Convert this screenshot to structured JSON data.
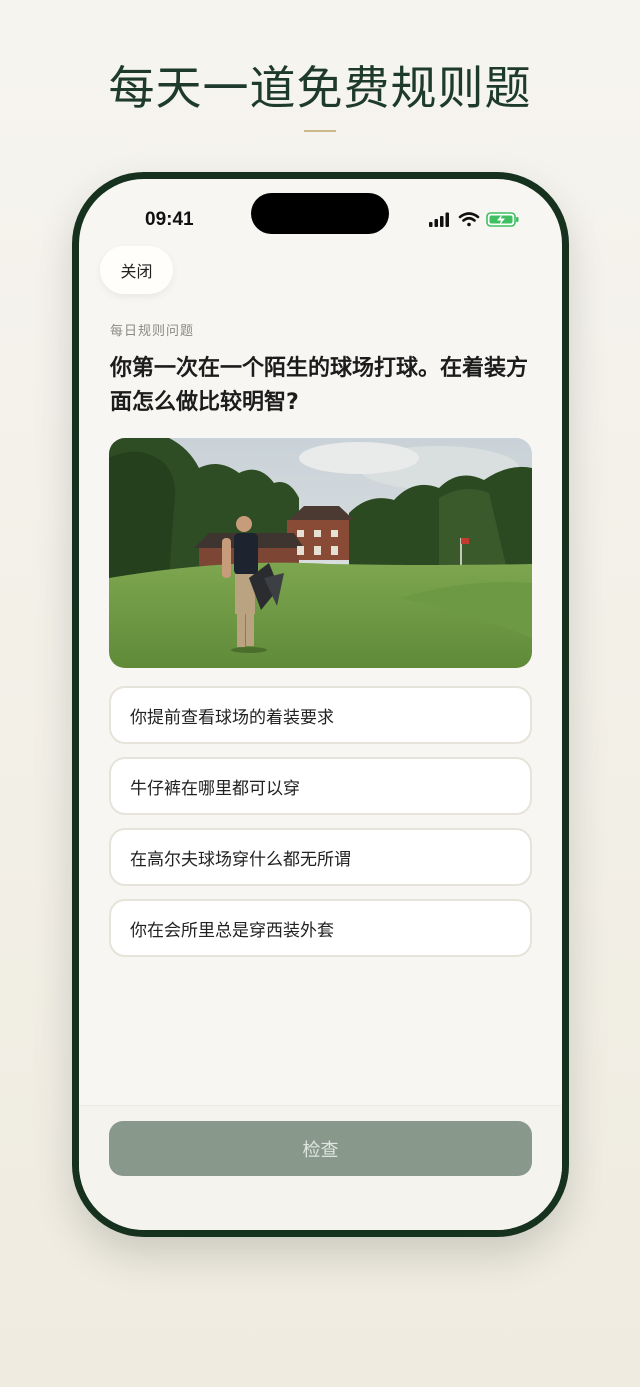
{
  "promo": {
    "headline": "每天一道免费规则题"
  },
  "status_bar": {
    "time": "09:41",
    "icons": [
      "signal-icon",
      "wifi-icon",
      "battery-charging-icon"
    ]
  },
  "close_label": "关闭",
  "eyebrow": "每日规则问题",
  "question": "你第一次在一个陌生的球场打球。在着装方面怎么做比较明智?",
  "answers": [
    "你提前查看球场的着装要求",
    "牛仔裤在哪里都可以穿",
    "在高尔夫球场穿什么都无所谓",
    "你在会所里总是穿西装外套"
  ],
  "check_label": "检查",
  "colors": {
    "brand_green": "#16321f",
    "button_disabled": "#88998c",
    "gold_accent": "#cdb88a"
  }
}
